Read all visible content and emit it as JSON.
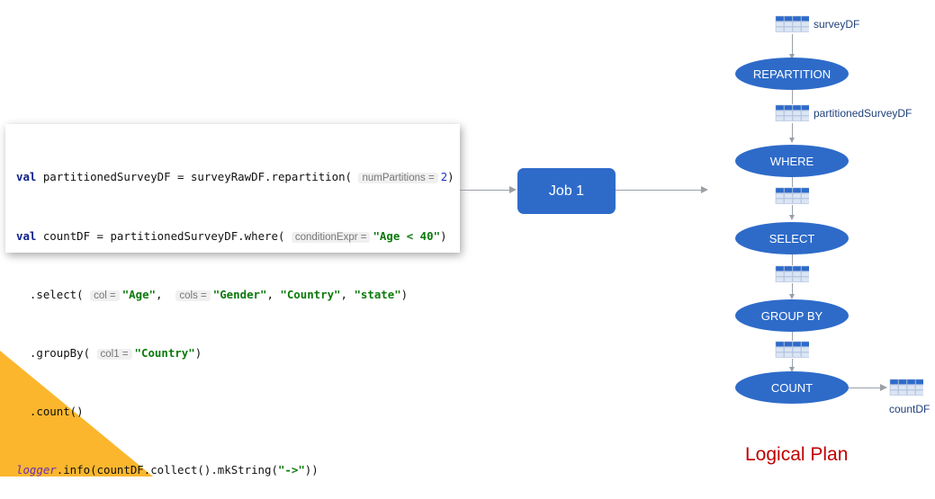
{
  "code": {
    "line1": {
      "kw": "val",
      "a": " partitionedSurveyDF = surveyRawDF.repartition( ",
      "hint": "numPartitions =",
      "num": "2",
      "b": ")"
    },
    "line2": {
      "kw": "val",
      "a": " countDF = partitionedSurveyDF.where( ",
      "hint": "conditionExpr =",
      "str": "\"Age < 40\"",
      "b": ")"
    },
    "line3": {
      "a": "  .select( ",
      "hint1": "col =",
      "str1": "\"Age\"",
      "c": ",  ",
      "hint2": "cols =",
      "str2": "\"Gender\"",
      "d": ", ",
      "str3": "\"Country\"",
      "e": ", ",
      "str4": "\"state\"",
      "b": ")"
    },
    "line4": {
      "a": "  .groupBy( ",
      "hint": "col1 =",
      "str": "\"Country\"",
      "b": ")"
    },
    "line5": {
      "a": "  .count()"
    },
    "line6": {
      "ital": "logger",
      "a": ".info(countDF.collect().mkString(",
      "str": "\"->\"",
      "b": "))"
    }
  },
  "job": {
    "label": "Job 1"
  },
  "plan": {
    "title": "Logical Plan",
    "nodes": [
      "REPARTITION",
      "WHERE",
      "SELECT",
      "GROUP BY",
      "COUNT"
    ],
    "dataframes": {
      "top": "surveyDF",
      "second": "partitionedSurveyDF",
      "final": "countDF"
    }
  }
}
